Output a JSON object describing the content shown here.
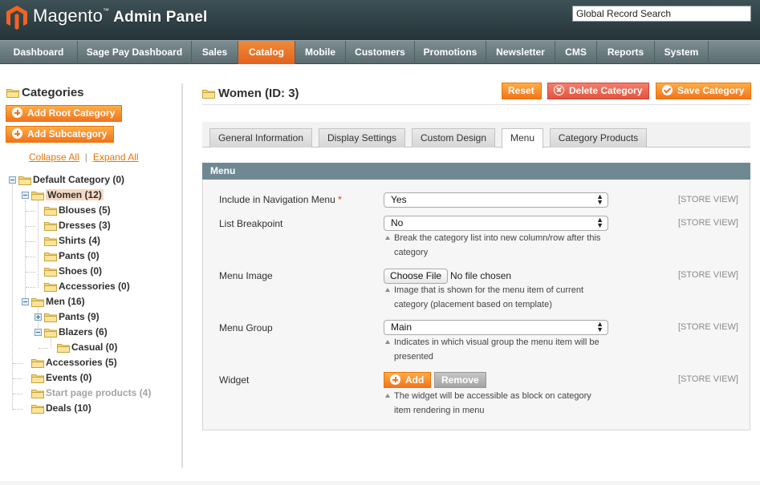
{
  "header": {
    "logo_brand": "Magento",
    "logo_tm": "™",
    "logo_sub": "Admin Panel",
    "global_search_value": "Global Record Search"
  },
  "nav": {
    "items": [
      {
        "label": "Dashboard"
      },
      {
        "label": "Sage Pay Dashboard"
      },
      {
        "label": "Sales"
      },
      {
        "label": "Catalog",
        "active": true
      },
      {
        "label": "Mobile"
      },
      {
        "label": "Customers"
      },
      {
        "label": "Promotions"
      },
      {
        "label": "Newsletter"
      },
      {
        "label": "CMS"
      },
      {
        "label": "Reports"
      },
      {
        "label": "System"
      }
    ]
  },
  "sidebar": {
    "title": "Categories",
    "add_root_label": "Add Root Category",
    "add_sub_label": "Add Subcategory",
    "collapse_label": "Collapse All",
    "separator": "|",
    "expand_label": "Expand All",
    "tree": [
      {
        "label": "Default Category (0)",
        "level": 0,
        "expander": "minus"
      },
      {
        "label": "Women (12)",
        "level": 1,
        "expander": "minus",
        "selected": true
      },
      {
        "label": "Blouses (5)",
        "level": 2
      },
      {
        "label": "Dresses (3)",
        "level": 2
      },
      {
        "label": "Shirts (4)",
        "level": 2
      },
      {
        "label": "Pants (0)",
        "level": 2
      },
      {
        "label": "Shoes (0)",
        "level": 2
      },
      {
        "label": "Accessories (0)",
        "level": 2
      },
      {
        "label": "Men (16)",
        "level": 1,
        "expander": "minus"
      },
      {
        "label": "Pants (9)",
        "level": 2,
        "expander": "plus"
      },
      {
        "label": "Blazers (6)",
        "level": 2,
        "expander": "minus"
      },
      {
        "label": "Casual (0)",
        "level": 3
      },
      {
        "label": "Accessories (5)",
        "level": 1
      },
      {
        "label": "Events (0)",
        "level": 1
      },
      {
        "label": "Start page products (4)",
        "level": 1,
        "dim": true
      },
      {
        "label": "Deals (10)",
        "level": 1
      }
    ]
  },
  "main": {
    "title": "Women (ID: 3)",
    "reset_label": "Reset",
    "delete_label": "Delete Category",
    "save_label": "Save Category",
    "tabs": [
      {
        "label": "General Information"
      },
      {
        "label": "Display Settings"
      },
      {
        "label": "Custom Design"
      },
      {
        "label": "Menu",
        "active": true
      },
      {
        "label": "Category Products"
      }
    ],
    "fieldset_title": "Menu",
    "scope_label": "[STORE VIEW]",
    "fields": {
      "include_nav": {
        "label": "Include in Navigation Menu",
        "required": "*",
        "value": "Yes"
      },
      "breakpoint": {
        "label": "List Breakpoint",
        "value": "No",
        "note": "Break the category list into new column/row after this category"
      },
      "menu_image": {
        "label": "Menu Image",
        "button": "Choose File",
        "status": "No file chosen",
        "note": "Image that is shown for the menu item of current category (placement based on template)"
      },
      "menu_group": {
        "label": "Menu Group",
        "value": "Main",
        "note": "Indicates in which visual group the menu item will be presented"
      },
      "widget": {
        "label": "Widget",
        "add_label": "Add",
        "remove_label": "Remove",
        "note": "The widget will be accessible as block on category item rendering in menu"
      }
    }
  },
  "colors": {
    "accent_orange": "#f1741c",
    "nav_active": "#e3631c",
    "fieldset_header": "#6f8992",
    "selected_node": "#f6d8c2"
  }
}
